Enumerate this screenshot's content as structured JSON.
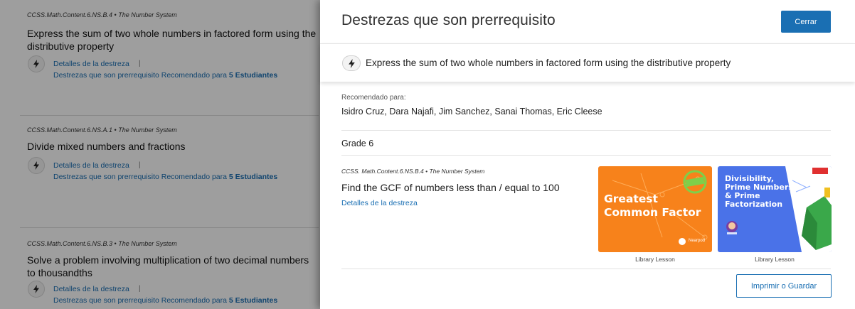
{
  "background": {
    "cards": [
      {
        "standard": "CCSS.Math.Content.6.NS.B.4 • The Number System",
        "title": "Express the sum of two whole numbers in factored form using the distributive property",
        "details_link": "Detalles de la destreza",
        "separator": "|",
        "prereq_link": "Destrezas que son prerrequisito",
        "recommended_for": "Recomendado para",
        "students": "5 Estudiantes"
      },
      {
        "standard": "CCSS.Math.Content.6.NS.A.1 • The Number System",
        "title": "Divide mixed numbers and fractions",
        "details_link": "Detalles de la destreza",
        "separator": "|",
        "prereq_link": "Destrezas que son prerrequisito",
        "recommended_for": "Recomendado para",
        "students": "5 Estudiantes"
      },
      {
        "standard": "CCSS.Math.Content.6.NS.B.3 • The Number System",
        "title": "Solve a problem involving multiplication of two decimal numbers to thousandths",
        "details_link": "Detalles de la destreza",
        "separator": "|",
        "prereq_link": "Destrezas que son prerrequisito",
        "recommended_for": "Recomendado para",
        "students": "5 Estudiantes"
      }
    ]
  },
  "panel": {
    "title": "Destrezas que son prerrequisito",
    "close_label": "Cerrar",
    "skill": {
      "icon": "lightning-bolt-icon",
      "text": "Express the sum of two whole numbers in factored form using the distributive property"
    },
    "recommended_label": "Recomendado para:",
    "recommended_names": "Isidro Cruz, Dara Najafi, Jim Sanchez, Sanai Thomas, Eric Cleese",
    "grade": "Grade 6",
    "prerequisite": {
      "standard": "CCSS. Math.Content.6.NS.B.4 • The Number System",
      "title": "Find the GCF of numbers less than / equal to 100",
      "details_link": "Detalles de la destreza"
    },
    "lessons": [
      {
        "title_line1": "Greatest",
        "title_line2": "Common Factor",
        "badge": "Nearpod",
        "caption": "Library Lesson",
        "bg_color": "#f7821b"
      },
      {
        "title_line1": "Divisibility,",
        "title_line2": "Prime Numbers",
        "title_line3": "& Prime",
        "title_line4": "Factorization",
        "caption": "Library Lesson",
        "bg_color": "#4a72e8"
      }
    ],
    "print_label": "Imprimir o Guardar"
  },
  "colors": {
    "accent": "#1a6fb3",
    "overlay": "rgba(0,0,0,0.38)"
  }
}
